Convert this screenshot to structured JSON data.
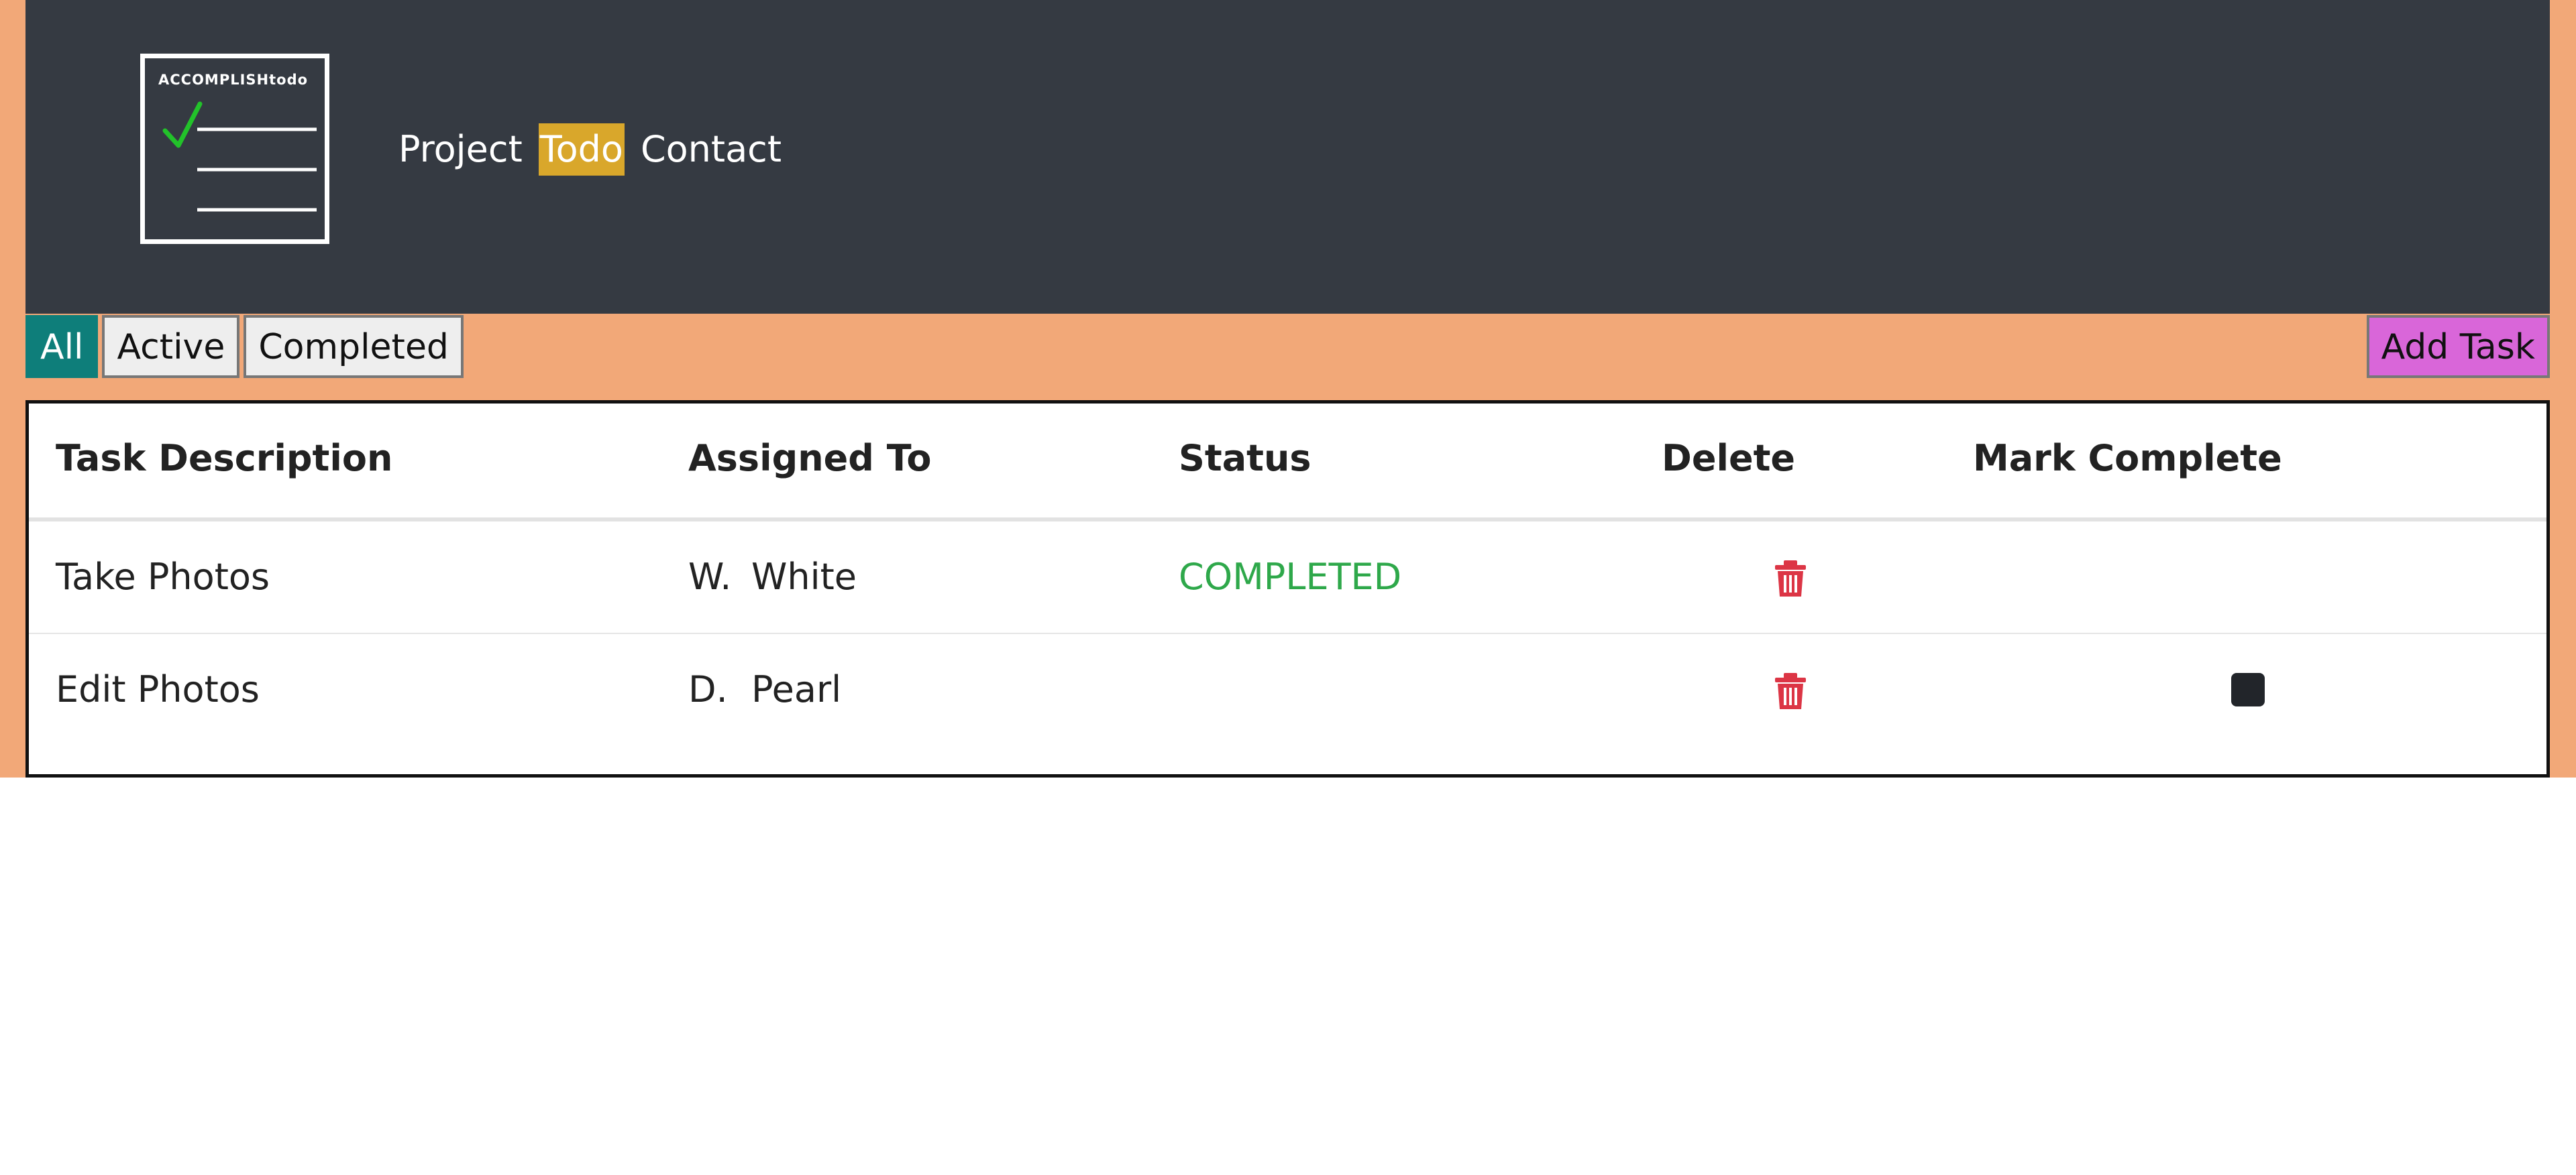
{
  "logo": {
    "text": "ACCOMPLISHtodo",
    "check_color": "#22c22a"
  },
  "nav": {
    "items": [
      {
        "label": "Project",
        "active": false
      },
      {
        "label": "Todo",
        "active": true
      },
      {
        "label": "Contact",
        "active": false
      }
    ]
  },
  "filters": {
    "all_label": "All",
    "active_label": "Active",
    "completed_label": "Completed",
    "selected": "All"
  },
  "add_task_label": "Add Task",
  "table": {
    "headers": {
      "description": "Task Description",
      "assigned": "Assigned To",
      "status": "Status",
      "delete": "Delete",
      "mark_complete": "Mark Complete"
    },
    "rows": [
      {
        "description": "Take Photos",
        "assigned_first": "W.",
        "assigned_last": "White",
        "status": "COMPLETED",
        "delete_icon": "trash-icon",
        "mark_complete": false
      },
      {
        "description": "Edit Photos",
        "assigned_first": "D.",
        "assigned_last": "Pearl",
        "status": "",
        "delete_icon": "trash-icon",
        "mark_complete": true
      }
    ]
  },
  "colors": {
    "page_background": "#f2a878",
    "navbar": "#353a42",
    "active_nav": "#d9a72b",
    "filter_selected": "#0e7e7a",
    "add_task": "#d966d9",
    "status_completed": "#2ea84a",
    "delete_icon": "#dc3545"
  }
}
